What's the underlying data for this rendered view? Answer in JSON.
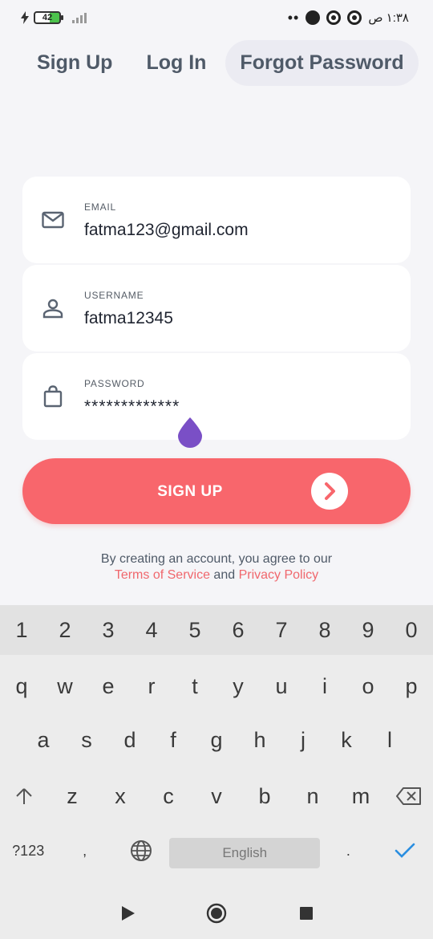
{
  "status_bar": {
    "battery": "42",
    "time": "١:٣٨ ص"
  },
  "tabs": [
    {
      "label": "Sign Up",
      "active": false
    },
    {
      "label": "Log In",
      "active": false
    },
    {
      "label": "Forgot Password",
      "active": true
    }
  ],
  "form": {
    "email": {
      "label": "EMAIL",
      "value": "fatma123@gmail.com",
      "icon": "mail-icon"
    },
    "username": {
      "label": "USERNAME",
      "value": "fatma12345",
      "icon": "person-icon"
    },
    "password": {
      "label": "PASSWORD",
      "value": "*************",
      "icon": "bag-icon"
    }
  },
  "signup_button": {
    "label": "SIGN UP"
  },
  "terms": {
    "prefix": "By creating an account, you agree to our",
    "tos": "Terms of Service",
    "and": "and",
    "privacy": "Privacy Policy"
  },
  "keyboard": {
    "numbers": [
      "1",
      "2",
      "3",
      "4",
      "5",
      "6",
      "7",
      "8",
      "9",
      "0"
    ],
    "row1": [
      "q",
      "w",
      "e",
      "r",
      "t",
      "y",
      "u",
      "i",
      "o",
      "p"
    ],
    "row2": [
      "a",
      "s",
      "d",
      "f",
      "g",
      "h",
      "j",
      "k",
      "l"
    ],
    "row3": [
      "z",
      "x",
      "c",
      "v",
      "b",
      "n",
      "m"
    ],
    "symbols_key": "?123",
    "comma": ",",
    "space": "English",
    "period": "."
  },
  "colors": {
    "accent": "#f8666c",
    "tab_text": "#4f5a68",
    "cursor_drop": "#7a4fc6",
    "enter_check": "#2a8ee0"
  }
}
